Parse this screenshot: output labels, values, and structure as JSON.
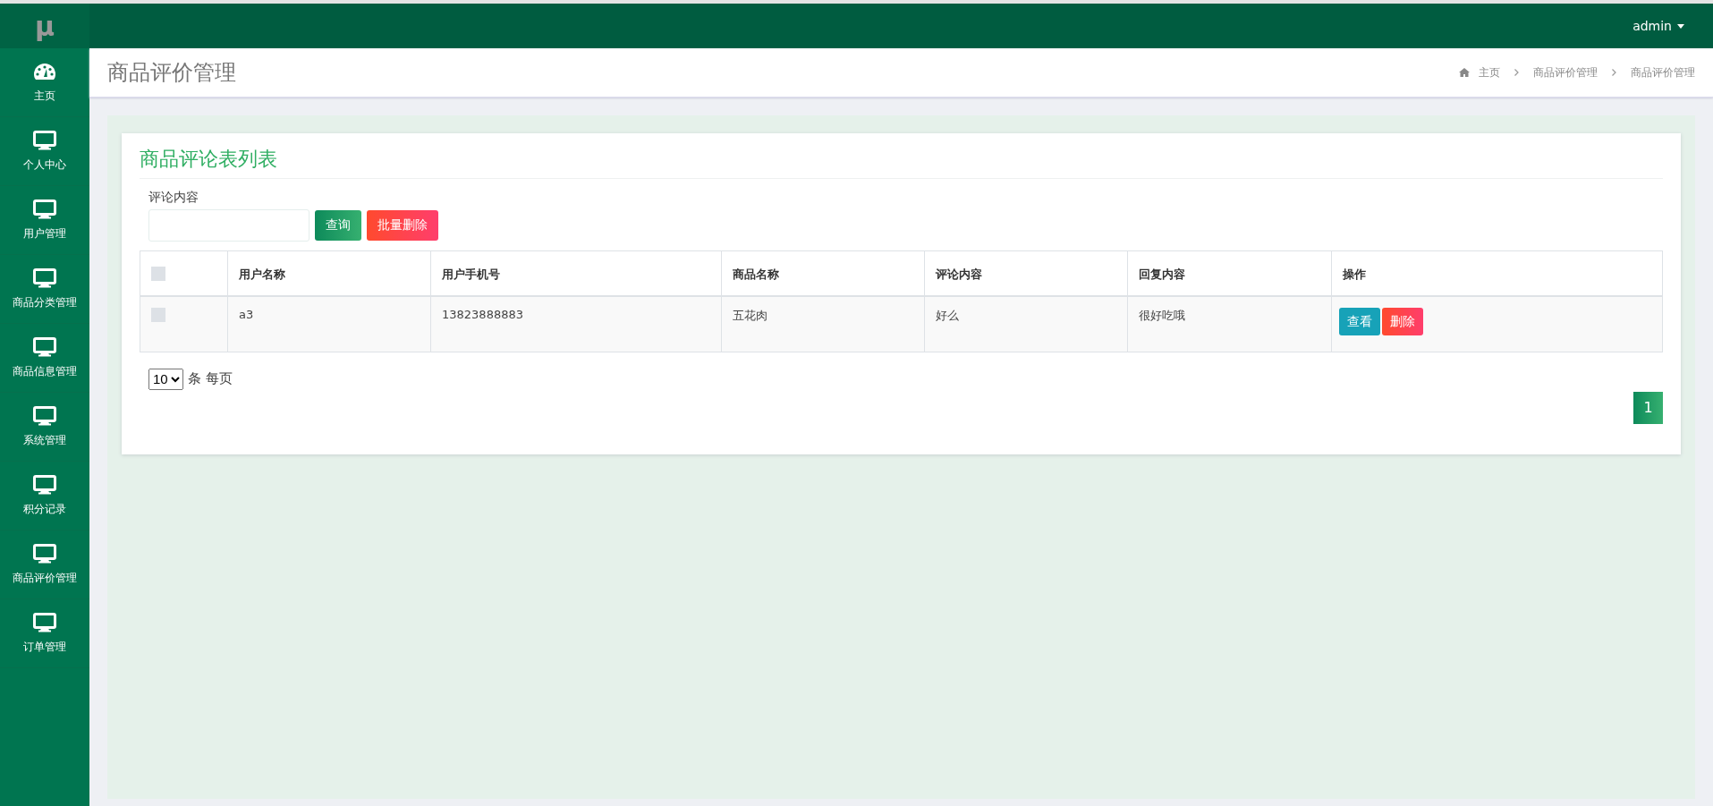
{
  "logo": "μ",
  "sidebar": {
    "items": [
      {
        "label": "主页",
        "kind": "dashboard"
      },
      {
        "label": "个人中心",
        "kind": "monitor"
      },
      {
        "label": "用户管理",
        "kind": "monitor"
      },
      {
        "label": "商品分类管理",
        "kind": "monitor"
      },
      {
        "label": "商品信息管理",
        "kind": "monitor"
      },
      {
        "label": "系统管理",
        "kind": "monitor"
      },
      {
        "label": "积分记录",
        "kind": "monitor"
      },
      {
        "label": "商品评价管理",
        "kind": "monitor"
      },
      {
        "label": "订单管理",
        "kind": "monitor"
      }
    ]
  },
  "user_menu": "admin",
  "page_title": "商品评价管理",
  "breadcrumb": [
    "主页",
    "商品评价管理",
    "商品评价管理"
  ],
  "card": {
    "title": "商品评论表列表",
    "search": {
      "label": "评论内容"
    },
    "buttons": [
      {
        "label": "查询",
        "kind": "primary"
      },
      {
        "label": "批量删除",
        "kind": "danger"
      }
    ],
    "table": {
      "select_all": {
        "checked": false
      },
      "columns": [
        "用户名称",
        "用户手机号",
        "商品名称",
        "评论内容",
        "回复内容",
        "操作"
      ],
      "rows": [
        {
          "checked": false,
          "cells": [
            "a3",
            "13823888883",
            "五花肉",
            "好么",
            "很好吃哦"
          ],
          "actions": [
            {
              "label": "查看",
              "kind": "view"
            },
            {
              "label": "删除",
              "kind": "delete"
            }
          ]
        }
      ]
    },
    "page_size": "10",
    "page_size_suffix": "条 每页",
    "pages": [
      {
        "label": "1",
        "selected": true
      }
    ]
  }
}
